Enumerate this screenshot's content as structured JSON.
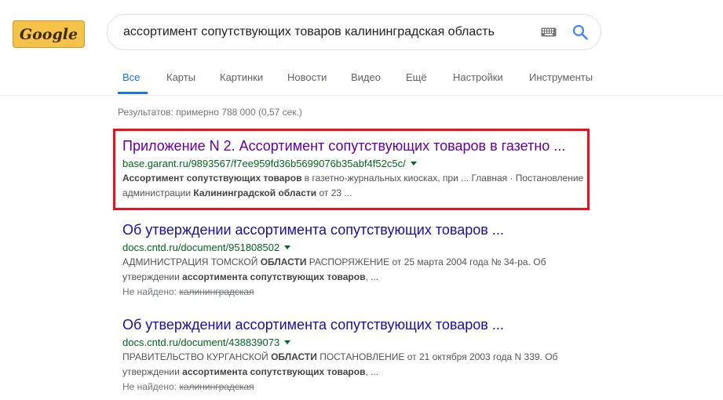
{
  "logo": {
    "text": "Google"
  },
  "search": {
    "query": "ассортимент сопутствующих товаров калининградская область"
  },
  "tabs": [
    {
      "label": "Все"
    },
    {
      "label": "Карты"
    },
    {
      "label": "Картинки"
    },
    {
      "label": "Новости"
    },
    {
      "label": "Видео"
    },
    {
      "label": "Ещё"
    },
    {
      "label": "Настройки"
    },
    {
      "label": "Инструменты"
    }
  ],
  "stats": "Результатов: примерно 788 000 (0,57 сек.)",
  "results": [
    {
      "title": "Приложение N 2. Ассортимент сопутствующих товаров в газетно ...",
      "url": "base.garant.ru/9893567/f7ee959fd36b5699076b35abf4f52c5c/",
      "snippet": [
        {
          "text": "Ассортимент сопутствующих товаров",
          "bold": true
        },
        {
          "text": " в газетно-журнальных киосках, при ... Главная · Постановление администрации ",
          "bold": false
        },
        {
          "text": "Калининградской области",
          "bold": true
        },
        {
          "text": " от 23 ...",
          "bold": false
        }
      ]
    },
    {
      "title": "Об утверждении ассортимента сопутствующих товаров ...",
      "url": "docs.cntd.ru/document/951808502",
      "snippet": [
        {
          "text": "АДМИНИСТРАЦИЯ ТОМСКОЙ ",
          "bold": false
        },
        {
          "text": "ОБЛАСТИ",
          "bold": true
        },
        {
          "text": " РАСПОРЯЖЕНИЕ от 25 марта 2004 года № 34-ра. Об утверждении ",
          "bold": false
        },
        {
          "text": "ассортимента сопутствующих товаров",
          "bold": true
        },
        {
          "text": ", ...",
          "bold": false
        }
      ],
      "missing_label": "Не найдено:",
      "missing_term": "калининградская"
    },
    {
      "title": "Об утверждении ассортимента сопутствующих товаров ...",
      "url": "docs.cntd.ru/document/438839073",
      "snippet": [
        {
          "text": "ПРАВИТЕЛЬСТВО КУРГАНСКОЙ ",
          "bold": false
        },
        {
          "text": "ОБЛАСТИ",
          "bold": true
        },
        {
          "text": " ПОСТАНОВЛЕНИЕ от 21 октября 2003 года N 339. Об утверждении ",
          "bold": false
        },
        {
          "text": "ассортимента сопутствующих товаров",
          "bold": true
        },
        {
          "text": ", ...",
          "bold": false
        }
      ],
      "missing_label": "Не найдено:",
      "missing_term": "калининградская"
    }
  ],
  "colors": {
    "link": "#1a0dab",
    "visited": "#660099",
    "url": "#006621",
    "active_tab": "#1a73e8",
    "highlight": "#e8111d"
  },
  "icons": [
    "keyboard-icon",
    "search-icon",
    "chevron-down-icon"
  ]
}
